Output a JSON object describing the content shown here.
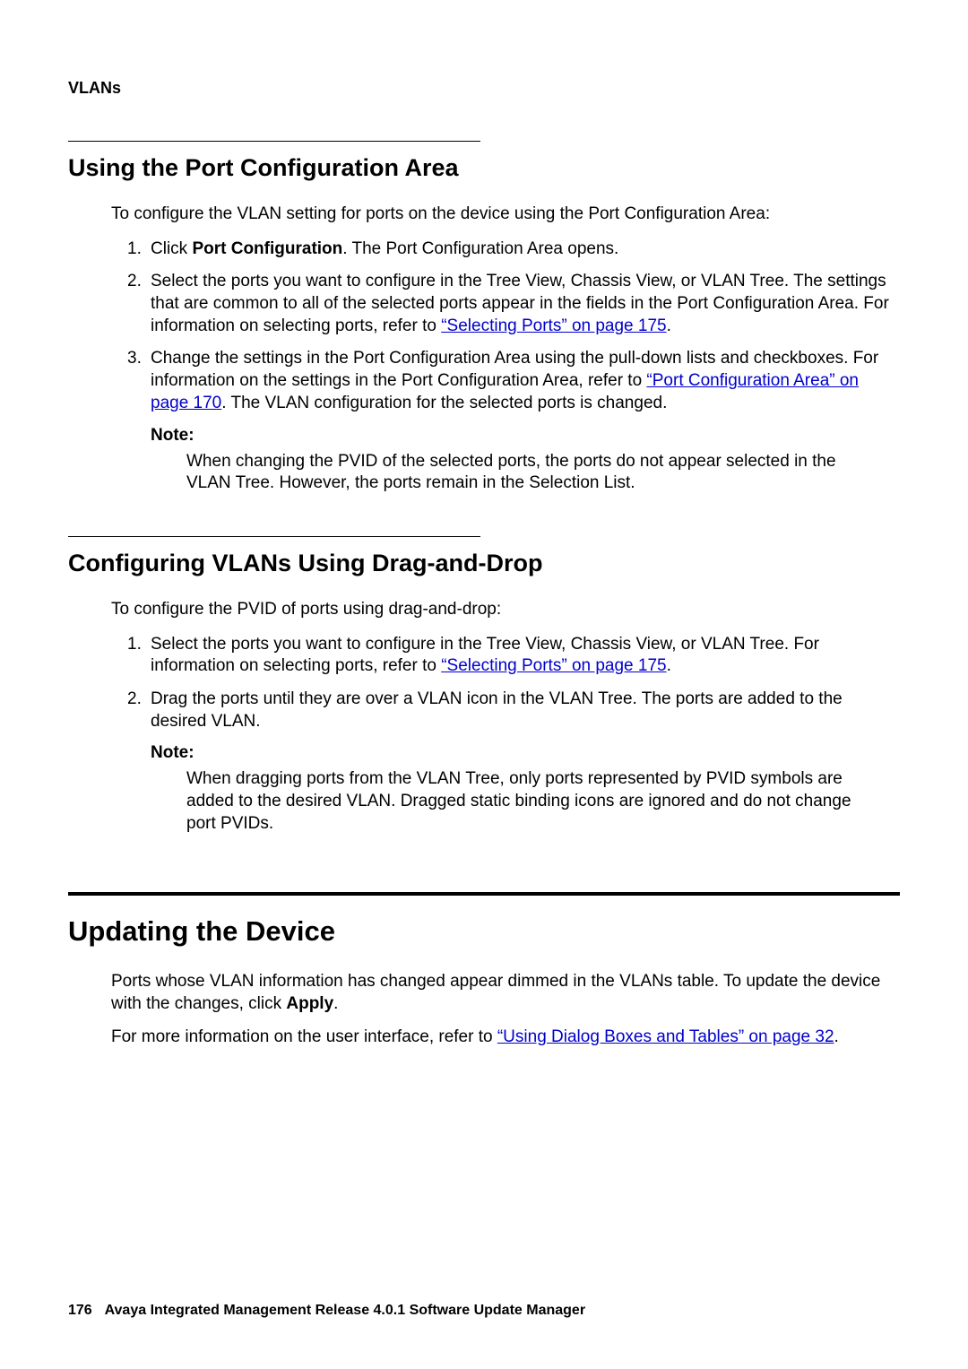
{
  "header": {
    "label": "VLANs"
  },
  "section1": {
    "title": "Using the Port Configuration Area",
    "intro": "To configure the VLAN setting for ports on the device using the Port Configuration Area:",
    "items": {
      "i1": {
        "num": "1.",
        "pre": "Click ",
        "bold": "Port Configuration",
        "post": ". The Port Configuration Area opens."
      },
      "i2": {
        "num": "2.",
        "pre": "Select the ports you want to configure in the Tree View, Chassis View, or VLAN Tree. The settings that are common to all of the selected ports appear in the fields in the Port Configuration Area. For information on selecting ports, refer to ",
        "link": "“Selecting Ports” on page 175",
        "post": "."
      },
      "i3": {
        "num": "3.",
        "pre": "Change the settings in the Port Configuration Area using the pull-down lists and checkboxes. For information on the settings in the Port Configuration Area, refer to ",
        "link": "“Port Configuration Area” on page 170",
        "post": ". The VLAN configuration for the selected ports is changed."
      }
    },
    "note_label": "Note:",
    "note_body": "When changing the PVID of the selected ports, the ports do not appear selected in the VLAN Tree. However, the ports remain in the Selection List."
  },
  "section2": {
    "title": "Configuring VLANs Using Drag-and-Drop",
    "intro": "To configure the PVID of ports using drag-and-drop:",
    "items": {
      "i1": {
        "num": "1.",
        "pre": "Select the ports you want to configure in the Tree View, Chassis View, or VLAN Tree. For information on selecting ports, refer to ",
        "link": "“Selecting Ports” on page 175",
        "post": "."
      },
      "i2": {
        "num": "2.",
        "text": "Drag the ports until they are over a VLAN icon in the VLAN Tree. The ports are added to the desired VLAN."
      }
    },
    "note_label": "Note:",
    "note_body": "When dragging ports from the VLAN Tree, only ports represented by PVID symbols are added to the desired VLAN. Dragged static binding icons are ignored and do not change port PVIDs."
  },
  "section3": {
    "title": "Updating the Device",
    "p1": {
      "pre": "Ports whose VLAN information has changed appear dimmed in the VLANs table. To update the device with the changes, click ",
      "bold": "Apply",
      "post": "."
    },
    "p2": {
      "pre": "For more information on the user interface, refer to ",
      "link": "“Using Dialog Boxes and Tables” on page 32",
      "post": "."
    }
  },
  "footer": {
    "page": "176",
    "title": "Avaya Integrated Management Release 4.0.1 Software Update Manager"
  }
}
